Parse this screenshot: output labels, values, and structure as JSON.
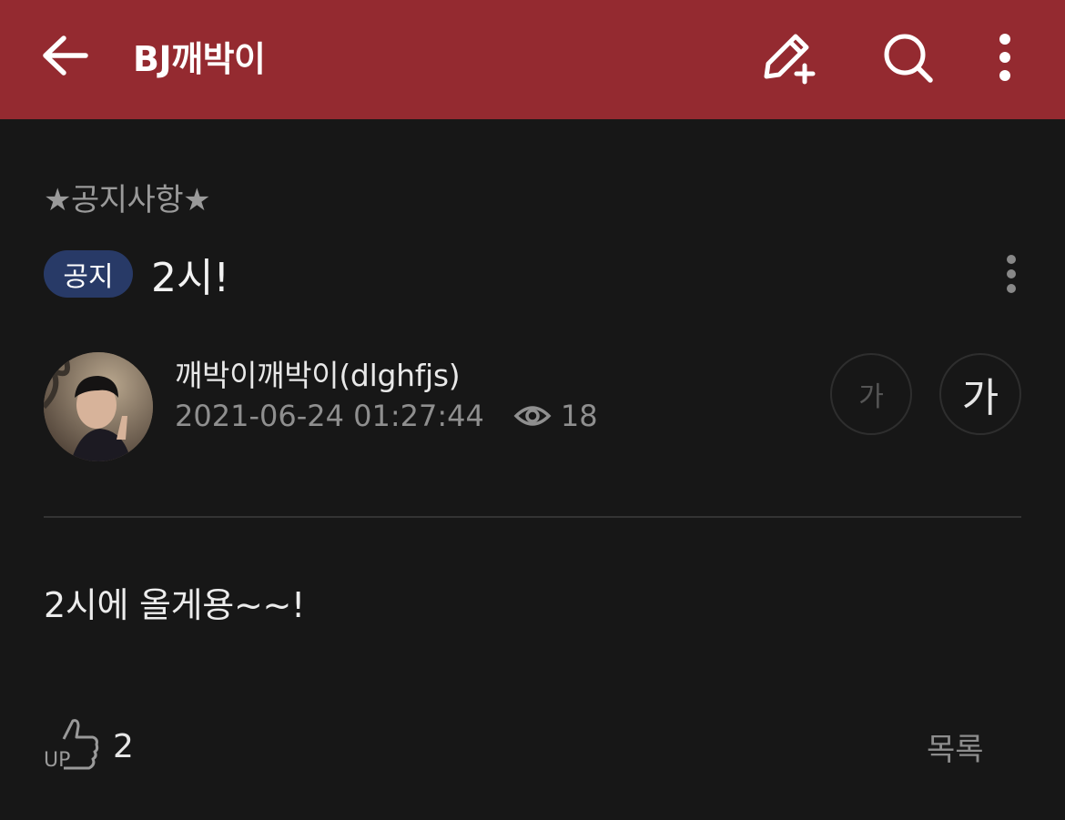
{
  "header": {
    "title": "BJ깨박이",
    "bg_color": "#942a30",
    "icons": [
      "back-arrow-icon",
      "write-icon",
      "search-icon",
      "more-vertical-icon"
    ]
  },
  "post": {
    "category": "★공지사항★",
    "badge": "공지",
    "badge_color": "#283a67",
    "title": "2시!",
    "author": "깨박이깨박이(dlghfjs)",
    "datetime": "2021-06-24 01:27:44",
    "views": "18",
    "font_small_label": "가",
    "font_large_label": "가",
    "body": "2시에 올게용~~!",
    "likes": "2",
    "list_label": "목록"
  }
}
